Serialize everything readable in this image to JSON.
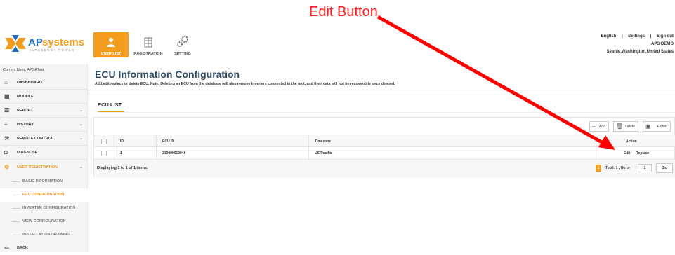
{
  "annotation": "Edit Button",
  "brand": {
    "name": "APsystems",
    "tagline": "ALTENERGY POWER",
    "orange": "#f39c1e",
    "blue": "#1e6bb8"
  },
  "topnav": [
    {
      "label": "USER LIST",
      "icon": "users-icon",
      "active": true
    },
    {
      "label": "REGISTRATION",
      "icon": "building-icon"
    },
    {
      "label": "SETTING",
      "icon": "gears-icon"
    }
  ],
  "topright": {
    "language": "English",
    "settings": "Settings",
    "signout": "Sign out",
    "sep": "|",
    "account": "APS DEMO",
    "location": "Seattle,Washington,United States"
  },
  "sidebar": {
    "current_user": "Current User: APSATest",
    "items": [
      {
        "label": "DASHBOARD",
        "icon": "home-icon"
      },
      {
        "label": "MODULE",
        "icon": "grid-icon"
      },
      {
        "label": "REPORT",
        "icon": "list-icon"
      },
      {
        "label": "HISTORY",
        "icon": "database-icon"
      },
      {
        "label": "REMOTE CONTROL",
        "icon": "wrench-icon"
      },
      {
        "label": "DIAGNOSE",
        "icon": "camera-icon"
      },
      {
        "label": "USER REGISTRATION",
        "icon": "gears-icon"
      }
    ],
    "sub_items": [
      {
        "label": "BASIC INFORMATION"
      },
      {
        "label": "ECU CONFIGURATION",
        "active": true
      },
      {
        "label": "INVERTER CONFIGURATION"
      },
      {
        "label": "VIEW CONFIGURATION"
      },
      {
        "label": "INSTALLATION DRAWING"
      }
    ],
    "back": "BACK"
  },
  "main": {
    "title": "ECU Information Configuration",
    "description": "Add,edit,replace or delete ECU. Note: Deleting an ECU from the database will also remove Inverters connected to the unit, and their data will not be recoverable once deleted.",
    "tab": "ECU LIST",
    "toolbar": {
      "add": "Add",
      "delete": "Delete",
      "export": "Export"
    },
    "columns": {
      "id": "ID",
      "ecu_id": "ECU ID",
      "timezone": "Timezone",
      "action": "Action"
    },
    "rows": [
      {
        "id": "1",
        "ecu_id": "213000019948",
        "timezone": "US/Pacific",
        "edit": "Edit",
        "replace": "Replace"
      }
    ],
    "pagination": {
      "display": "Displaying 1 to 1 of 1 items.",
      "page": "1",
      "total": "Total: 1 , Go to",
      "goto_value": "1",
      "go": "Go"
    }
  }
}
